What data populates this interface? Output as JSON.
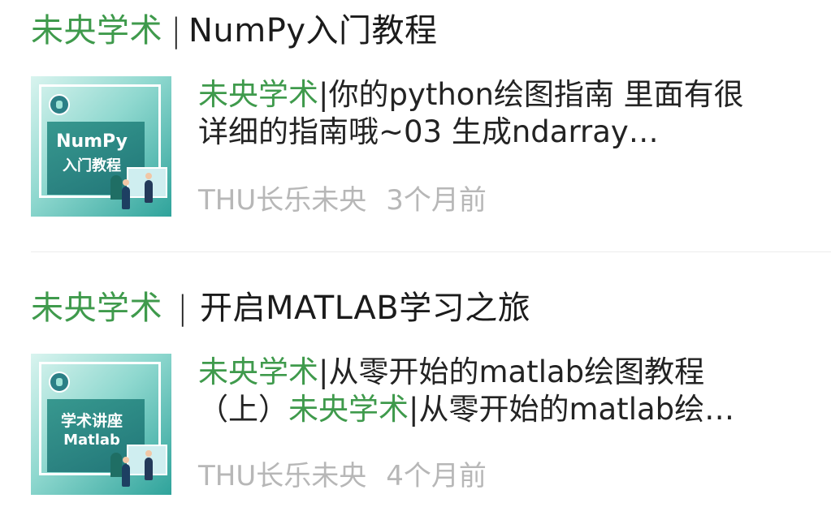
{
  "articles": [
    {
      "title_brand": "未央学术",
      "title_sep": "|",
      "title_text": "NumPy入门教程",
      "thumbnail": {
        "line1": "NumPy",
        "line2": "入门教程"
      },
      "desc_line1_brand": "未央学术",
      "desc_line1_rest": "|你的python绘图指南 里面有很",
      "desc_line2": "详细的指南哦~03 生成ndarray…",
      "source": "THU长乐未央",
      "time": "3个月前"
    },
    {
      "title_brand": "未央学术",
      "title_sep": "|",
      "title_text": "开启MATLAB学习之旅",
      "thumbnail": {
        "line1": "学术讲座",
        "line2": "Matlab"
      },
      "desc_line1_brand": "未央学术",
      "desc_line1_rest": "|从零开始的matlab绘图教程",
      "desc_line2_prefix": "（上）",
      "desc_line2_brand": "未央学术",
      "desc_line2_rest": "|从零开始的matlab绘…",
      "source": "THU长乐未央",
      "time": "4个月前"
    }
  ],
  "colors": {
    "brand_green": "#3f9a4c",
    "meta_gray": "#b7b7b7",
    "thumb_teal": "#2fa39b"
  }
}
